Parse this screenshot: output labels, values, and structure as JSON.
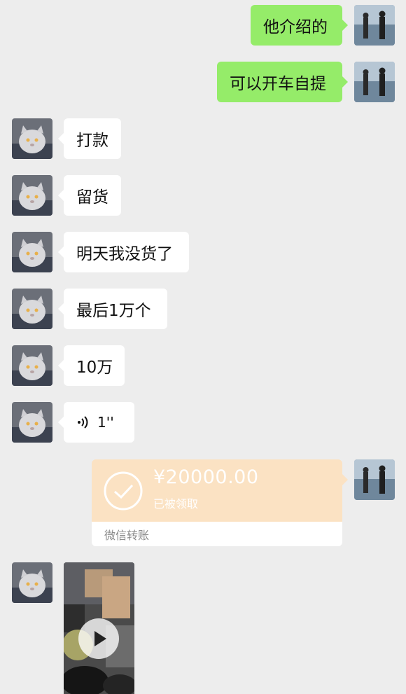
{
  "messages": [
    {
      "side": "out",
      "text": "他介绍的"
    },
    {
      "side": "out",
      "text": "可以开车自提"
    },
    {
      "side": "in",
      "text": "打款"
    },
    {
      "side": "in",
      "text": "留货"
    },
    {
      "side": "in",
      "text": "明天我没货了"
    },
    {
      "side": "in",
      "text": "最后1万个"
    },
    {
      "side": "in",
      "text": "10万"
    }
  ],
  "voice": {
    "duration": "1''",
    "icon": "voice-wave-icon"
  },
  "transfer": {
    "amount": "¥20000.00",
    "status": "已被领取",
    "footer": "微信转账",
    "icon": "check-circle-icon"
  },
  "video": {
    "icon": "play-icon"
  },
  "colors": {
    "background": "#ededed",
    "outgoing_bubble": "#95ec69",
    "incoming_bubble": "#ffffff",
    "transfer_card": "#fbe2c3"
  }
}
